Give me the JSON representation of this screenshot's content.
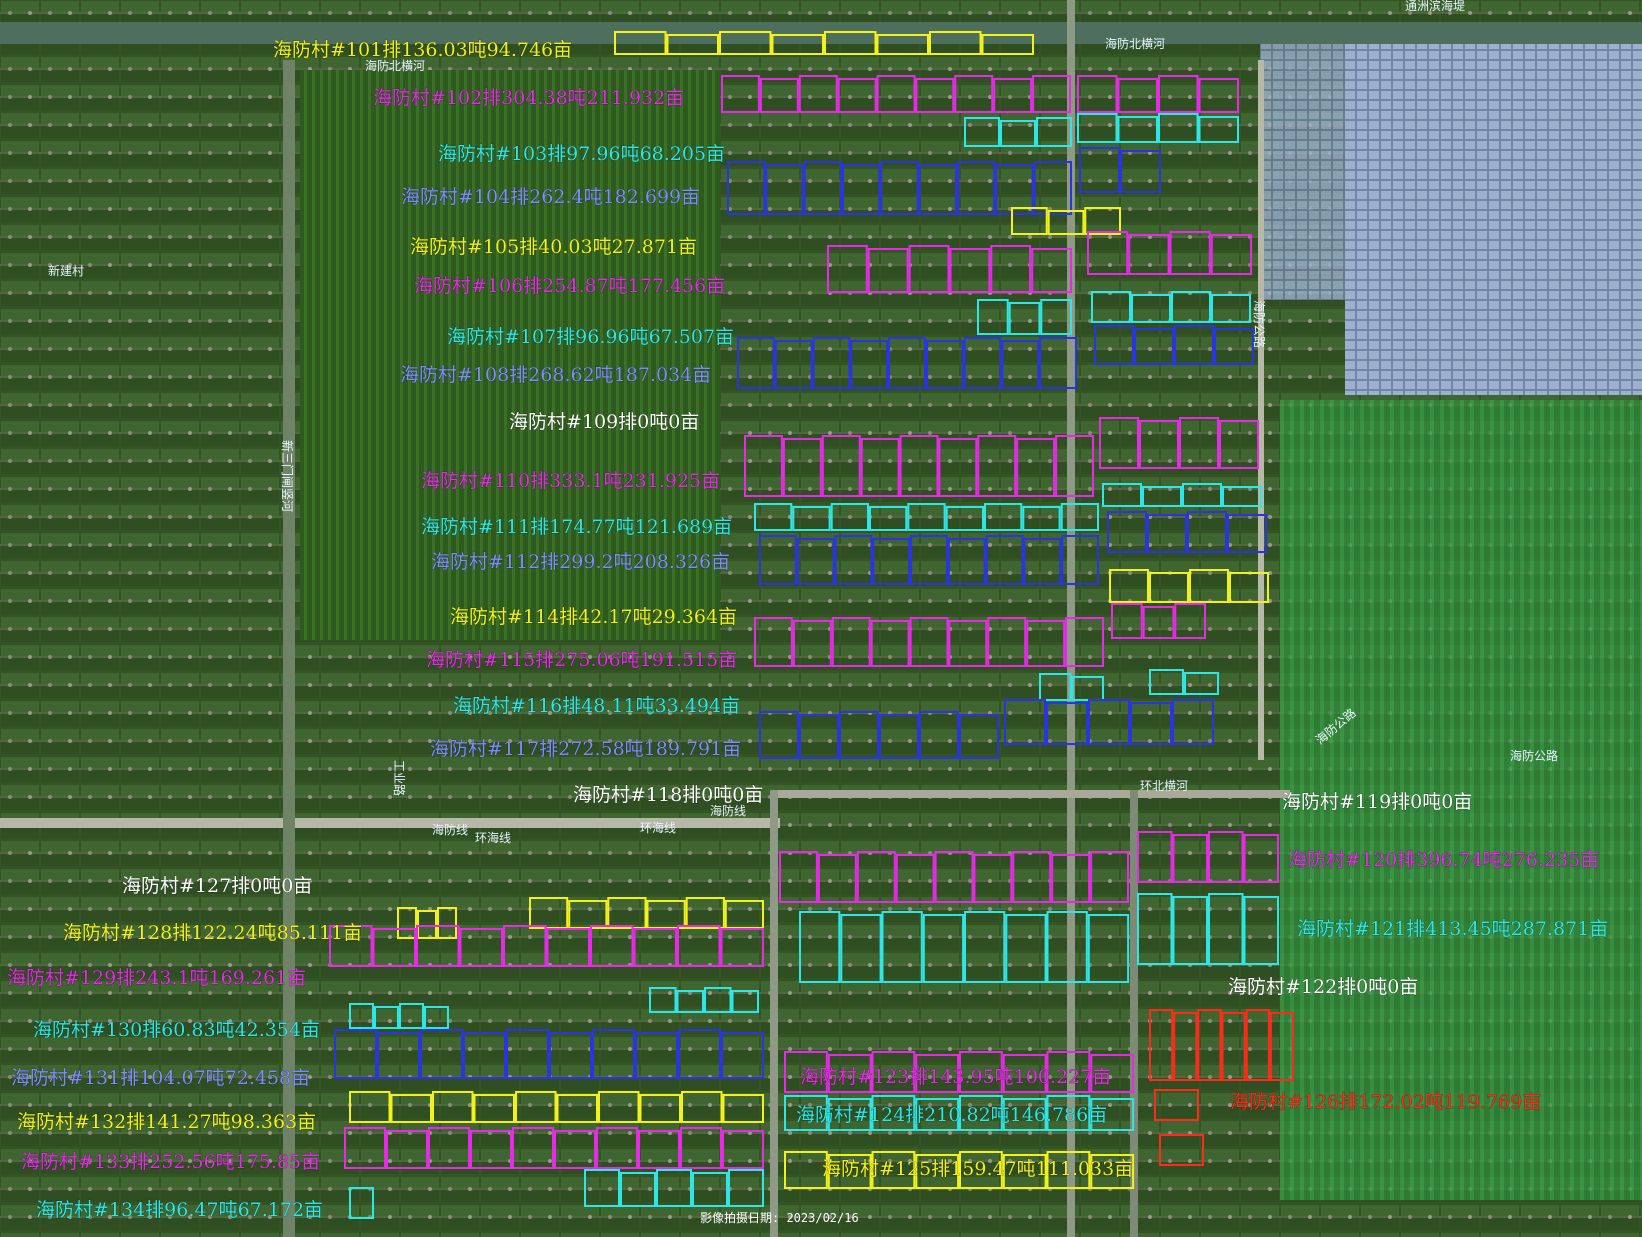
{
  "colors": {
    "yellow": "#f2f21a",
    "magenta": "#e52be5",
    "cyan": "#2ee6e6",
    "blue": "#2a34e0",
    "white": "#ffffff",
    "red": "#ff2a1a",
    "blue_label": "#7e8cff"
  },
  "labels": [
    {
      "id": "101",
      "text": "海防村#101排136.03吨94.746亩",
      "color": "yellow"
    },
    {
      "id": "102",
      "text": "海防村#102排304.38吨211.932亩",
      "color": "magenta"
    },
    {
      "id": "103",
      "text": "海防村#103排97.96吨68.205亩",
      "color": "cyan"
    },
    {
      "id": "104",
      "text": "海防村#104排262.4吨182.699亩",
      "color": "blue_label"
    },
    {
      "id": "105",
      "text": "海防村#105排40.03吨27.871亩",
      "color": "yellow"
    },
    {
      "id": "106",
      "text": "海防村#106排254.87吨177.456亩",
      "color": "magenta"
    },
    {
      "id": "107",
      "text": "海防村#107排96.96吨67.507亩",
      "color": "cyan"
    },
    {
      "id": "108",
      "text": "海防村#108排268.62吨187.034亩",
      "color": "blue_label"
    },
    {
      "id": "109",
      "text": "海防村#109排0吨0亩",
      "color": "white"
    },
    {
      "id": "110",
      "text": "海防村#110排333.1吨231.925亩",
      "color": "magenta"
    },
    {
      "id": "111",
      "text": "海防村#111排174.77吨121.689亩",
      "color": "cyan"
    },
    {
      "id": "112",
      "text": "海防村#112排299.2吨208.326亩",
      "color": "blue_label"
    },
    {
      "id": "114",
      "text": "海防村#114排42.17吨29.364亩",
      "color": "yellow"
    },
    {
      "id": "115",
      "text": "海防村#115排275.06吨191.515亩",
      "color": "magenta"
    },
    {
      "id": "116",
      "text": "海防村#116排48.11吨33.494亩",
      "color": "cyan"
    },
    {
      "id": "117",
      "text": "海防村#117排272.58吨189.791亩",
      "color": "blue_label"
    },
    {
      "id": "118",
      "text": "海防村#118排0吨0亩",
      "color": "white"
    },
    {
      "id": "119",
      "text": "海防村#119排0吨0亩",
      "color": "white"
    },
    {
      "id": "120",
      "text": "海防村#120排396.74吨276.235亩",
      "color": "magenta"
    },
    {
      "id": "121",
      "text": "海防村#121排413.45吨287.871亩",
      "color": "cyan"
    },
    {
      "id": "122",
      "text": "海防村#122排0吨0亩",
      "color": "white"
    },
    {
      "id": "123",
      "text": "海防村#123排143.95吨100.227亩",
      "color": "magenta"
    },
    {
      "id": "124",
      "text": "海防村#124排210.82吨146.786亩",
      "color": "cyan"
    },
    {
      "id": "125",
      "text": "海防村#125排159.47吨111.033亩",
      "color": "yellow"
    },
    {
      "id": "126",
      "text": "海防村#126排172.02吨119.769亩",
      "color": "red"
    },
    {
      "id": "127",
      "text": "海防村#127排0吨0亩",
      "color": "white"
    },
    {
      "id": "128",
      "text": "海防村#128排122.24吨85.111亩",
      "color": "yellow"
    },
    {
      "id": "129",
      "text": "海防村#129排243.1吨169.261亩",
      "color": "magenta"
    },
    {
      "id": "130",
      "text": "海防村#130排60.83吨42.354亩",
      "color": "cyan"
    },
    {
      "id": "131",
      "text": "海防村#131排104.07吨72.458亩",
      "color": "blue_label"
    },
    {
      "id": "132",
      "text": "海防村#132排141.27吨98.363亩",
      "color": "yellow"
    },
    {
      "id": "133",
      "text": "海防村#133排252.56吨175.85亩",
      "color": "magenta"
    },
    {
      "id": "134",
      "text": "海防村#134排96.47吨67.172亩",
      "color": "cyan"
    }
  ],
  "roads": {
    "haifang_north_river_1": "海防北横河",
    "haifang_north_river_2": "海防北横河",
    "tongzhou_road": "通洲滨海堤",
    "haifang_road_1": "海防公路",
    "haifang_road_2": "海防公路",
    "haifang_road_3": "海防公路",
    "xinsanmen_river": "新三门闸竖河",
    "xinjian_village": "新建村",
    "industry_road": "工业路",
    "huanbei_river": "环北横河",
    "haifang_line_1": "海防线",
    "haifang_line_2": "环海线",
    "haifang_line_3": "环海线",
    "haifang_line_4": "海防线"
  },
  "capture_date": "影像拍摄日期: 2023/02/16"
}
